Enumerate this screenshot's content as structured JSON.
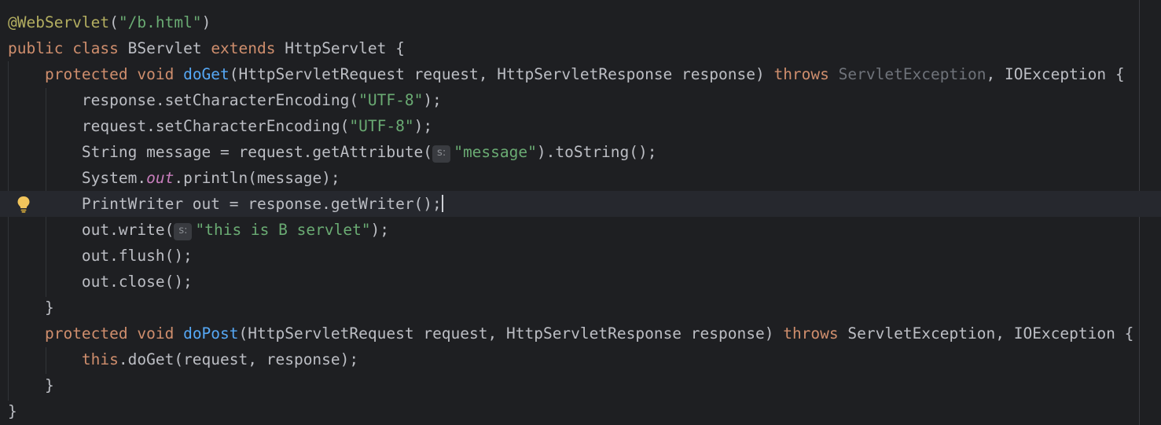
{
  "editor": {
    "lines": [
      {
        "tokens": [
          {
            "t": "@WebServlet",
            "c": "ann"
          },
          {
            "t": "(",
            "c": "plain"
          },
          {
            "t": "\"/b.html\"",
            "c": "str"
          },
          {
            "t": ")",
            "c": "plain"
          }
        ]
      },
      {
        "tokens": [
          {
            "t": "public ",
            "c": "kw"
          },
          {
            "t": "class ",
            "c": "kw"
          },
          {
            "t": "BServlet ",
            "c": "plain"
          },
          {
            "t": "extends ",
            "c": "kw"
          },
          {
            "t": "HttpServlet {",
            "c": "plain"
          }
        ]
      },
      {
        "tokens": [
          {
            "t": "    ",
            "c": "plain"
          },
          {
            "t": "protected ",
            "c": "kw"
          },
          {
            "t": "void ",
            "c": "kw"
          },
          {
            "t": "doGet",
            "c": "fn"
          },
          {
            "t": "(HttpServletRequest request, HttpServletResponse response) ",
            "c": "plain"
          },
          {
            "t": "throws ",
            "c": "kw"
          },
          {
            "t": "ServletException",
            "c": "dim"
          },
          {
            "t": ", IOException {",
            "c": "plain"
          }
        ]
      },
      {
        "tokens": [
          {
            "t": "        response.setCharacterEncoding(",
            "c": "plain"
          },
          {
            "t": "\"UTF-8\"",
            "c": "str"
          },
          {
            "t": ");",
            "c": "plain"
          }
        ]
      },
      {
        "tokens": [
          {
            "t": "        request.setCharacterEncoding(",
            "c": "plain"
          },
          {
            "t": "\"UTF-8\"",
            "c": "str"
          },
          {
            "t": ");",
            "c": "plain"
          }
        ]
      },
      {
        "tokens": [
          {
            "t": "        String message = request.getAttribute(",
            "c": "plain"
          },
          {
            "t": "s:",
            "c": "hint"
          },
          {
            "t": "\"message\"",
            "c": "str"
          },
          {
            "t": ").toString();",
            "c": "plain"
          }
        ]
      },
      {
        "tokens": [
          {
            "t": "        System.",
            "c": "plain"
          },
          {
            "t": "out",
            "c": "static"
          },
          {
            "t": ".println(message);",
            "c": "plain"
          }
        ]
      },
      {
        "tokens": [
          {
            "t": "        PrintWriter out = response.getWriter();",
            "c": "plain"
          },
          {
            "t": "",
            "c": "caret"
          }
        ],
        "current": true
      },
      {
        "tokens": [
          {
            "t": "        out.write(",
            "c": "plain"
          },
          {
            "t": "s:",
            "c": "hint"
          },
          {
            "t": "\"this is B servlet\"",
            "c": "str"
          },
          {
            "t": ");",
            "c": "plain"
          }
        ]
      },
      {
        "tokens": [
          {
            "t": "        out.flush();",
            "c": "plain"
          }
        ]
      },
      {
        "tokens": [
          {
            "t": "        out.close();",
            "c": "plain"
          }
        ]
      },
      {
        "tokens": [
          {
            "t": "    }",
            "c": "plain"
          }
        ]
      },
      {
        "tokens": [
          {
            "t": "    ",
            "c": "plain"
          },
          {
            "t": "protected ",
            "c": "kw"
          },
          {
            "t": "void ",
            "c": "kw"
          },
          {
            "t": "doPost",
            "c": "fn"
          },
          {
            "t": "(HttpServletRequest request, HttpServletResponse response) ",
            "c": "plain"
          },
          {
            "t": "throws ",
            "c": "kw"
          },
          {
            "t": "ServletException, IOException {",
            "c": "plain"
          }
        ]
      },
      {
        "tokens": [
          {
            "t": "        ",
            "c": "plain"
          },
          {
            "t": "this",
            "c": "kw"
          },
          {
            "t": ".doGet(request, response);",
            "c": "plain"
          }
        ]
      },
      {
        "tokens": [
          {
            "t": "    }",
            "c": "plain"
          }
        ]
      },
      {
        "tokens": [
          {
            "t": "}",
            "c": "plain"
          }
        ]
      }
    ],
    "gutter_icon": "lightbulb-icon"
  }
}
